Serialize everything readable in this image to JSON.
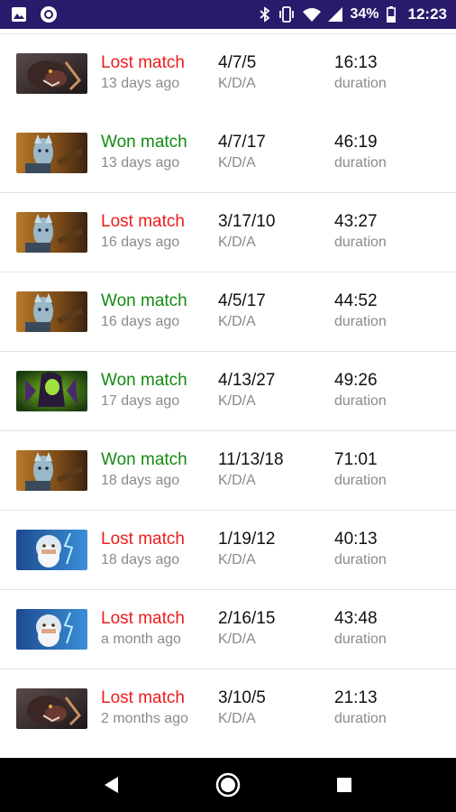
{
  "status_bar": {
    "battery": "34%",
    "time": "12:23",
    "icons": [
      "image-icon",
      "circle-app-icon",
      "bluetooth-icon",
      "vibrate-icon",
      "wifi-icon",
      "signal-icon",
      "battery-icon"
    ]
  },
  "matches": [
    {
      "hero": "ursa",
      "result": "Lost match",
      "won": false,
      "time_ago": "13 days ago",
      "kda": "4/7/5",
      "kda_label": "K/D/A",
      "duration": "16:13",
      "duration_label": "duration"
    },
    {
      "hero": "phantom",
      "result": "Won match",
      "won": true,
      "time_ago": "13 days ago",
      "kda": "4/7/17",
      "kda_label": "K/D/A",
      "duration": "46:19",
      "duration_label": "duration"
    },
    {
      "hero": "phantom",
      "result": "Lost match",
      "won": false,
      "time_ago": "16 days ago",
      "kda": "3/17/10",
      "kda_label": "K/D/A",
      "duration": "43:27",
      "duration_label": "duration"
    },
    {
      "hero": "phantom",
      "result": "Won match",
      "won": true,
      "time_ago": "16 days ago",
      "kda": "4/5/17",
      "kda_label": "K/D/A",
      "duration": "44:52",
      "duration_label": "duration"
    },
    {
      "hero": "venom",
      "result": "Won match",
      "won": true,
      "time_ago": "17 days ago",
      "kda": "4/13/27",
      "kda_label": "K/D/A",
      "duration": "49:26",
      "duration_label": "duration"
    },
    {
      "hero": "phantom",
      "result": "Won match",
      "won": true,
      "time_ago": "18 days ago",
      "kda": "11/13/18",
      "kda_label": "K/D/A",
      "duration": "71:01",
      "duration_label": "duration"
    },
    {
      "hero": "zeus",
      "result": "Lost match",
      "won": false,
      "time_ago": "18 days ago",
      "kda": "1/19/12",
      "kda_label": "K/D/A",
      "duration": "40:13",
      "duration_label": "duration"
    },
    {
      "hero": "zeus",
      "result": "Lost match",
      "won": false,
      "time_ago": "a month ago",
      "kda": "2/16/15",
      "kda_label": "K/D/A",
      "duration": "43:48",
      "duration_label": "duration"
    },
    {
      "hero": "ursa",
      "result": "Lost match",
      "won": false,
      "time_ago": "2 months ago",
      "kda": "3/10/5",
      "kda_label": "K/D/A",
      "duration": "21:13",
      "duration_label": "duration"
    }
  ],
  "nav": {
    "icons": [
      "back-icon",
      "home-icon",
      "recents-icon"
    ]
  },
  "colors": {
    "status_bar": "#2a1a6b",
    "lost": "#ee1c1c",
    "won": "#138a13",
    "secondary_text": "#8a8a8a"
  }
}
